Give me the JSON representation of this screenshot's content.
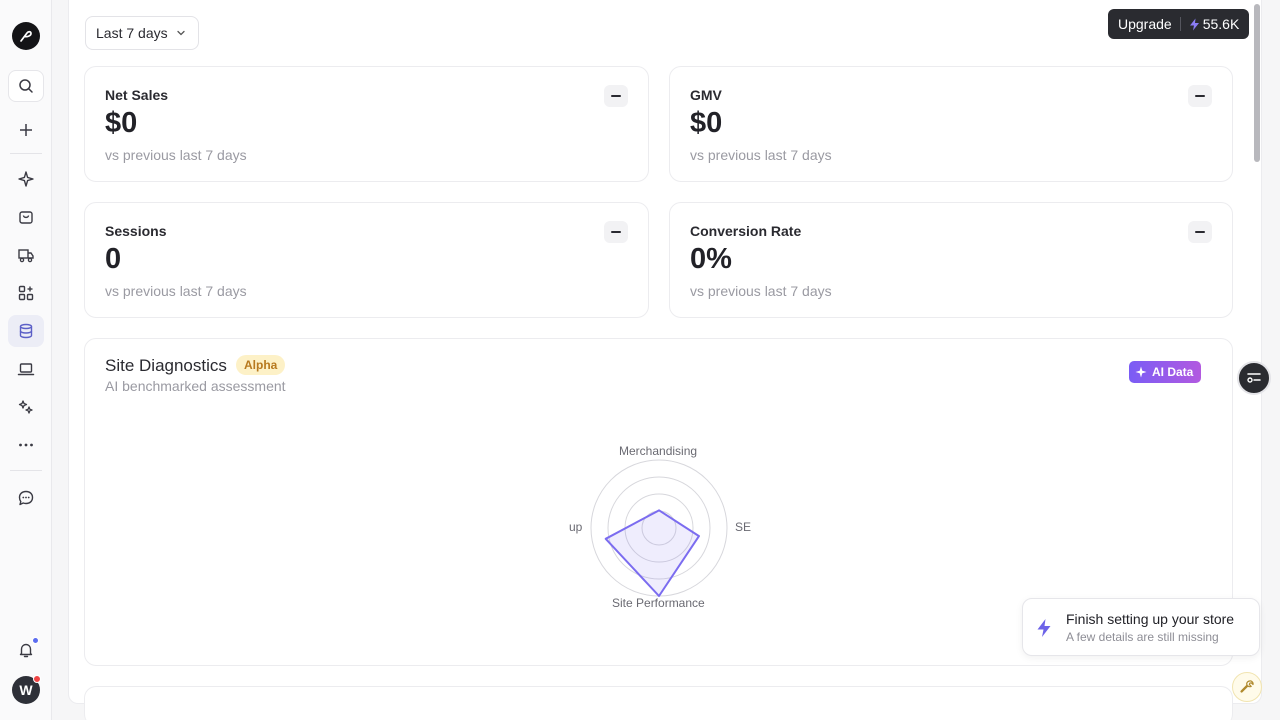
{
  "date_range": {
    "label": "Last 7 days"
  },
  "metrics": [
    {
      "title": "Net Sales",
      "value": "$0",
      "comparison": "vs previous last 7 days"
    },
    {
      "title": "GMV",
      "value": "$0",
      "comparison": "vs previous last 7 days"
    },
    {
      "title": "Sessions",
      "value": "0",
      "comparison": "vs previous last 7 days"
    },
    {
      "title": "Conversion Rate",
      "value": "0%",
      "comparison": "vs previous last 7 days"
    }
  ],
  "diagnostics": {
    "title": "Site Diagnostics",
    "badge": "Alpha",
    "subtitle": "AI benchmarked assessment",
    "ai_badge": "AI Data",
    "radar": {
      "axes": [
        "Merchandising",
        "SE",
        "Site Performance",
        "up"
      ],
      "values": [
        0.26,
        0.6,
        1.0,
        0.8
      ],
      "accent": "#7b6cf0"
    }
  },
  "upgrade": {
    "label": "Upgrade",
    "credits": "55.6K"
  },
  "toast": {
    "title": "Finish setting up your store",
    "subtitle": "A few details are still missing"
  },
  "user": {
    "initial": "W"
  },
  "colors": {
    "accent": "#5b5fc7",
    "brand_dark": "#141417",
    "ai_gradient_start": "#7a5cf5",
    "ai_gradient_end": "#b25ae0"
  }
}
